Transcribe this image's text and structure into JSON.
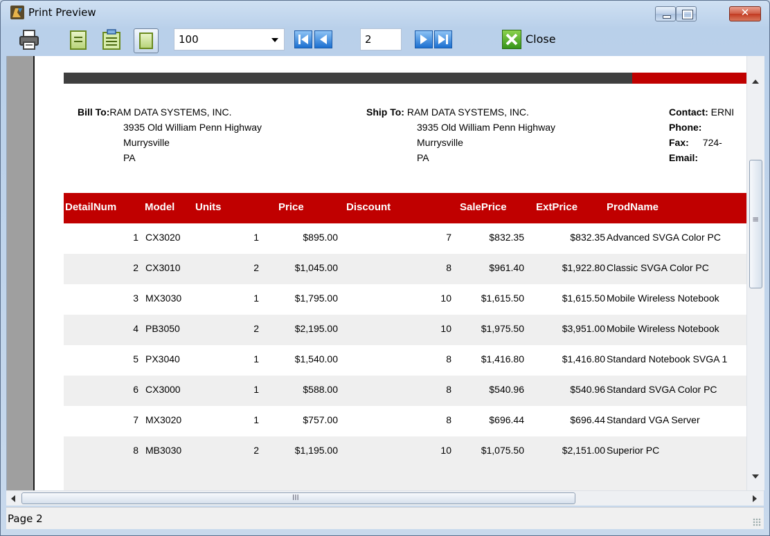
{
  "window": {
    "title": "Print Preview"
  },
  "toolbar": {
    "zoom_value": "100",
    "page_value": "2",
    "close_label": "Close"
  },
  "bill_to": {
    "label": "Bill To:",
    "name": "RAM DATA SYSTEMS, INC.",
    "street": "3935 Old William Penn Highway",
    "city": "Murrysville",
    "state": "PA"
  },
  "ship_to": {
    "label": "Ship To:",
    "name": "RAM DATA SYSTEMS, INC.",
    "street": "3935 Old William Penn Highway",
    "city": "Murrysville",
    "state": "PA"
  },
  "contact": {
    "contact_label": "Contact:",
    "contact_value": "ERNI",
    "phone_label": "Phone:",
    "fax_label": "Fax:",
    "fax_value": "724-",
    "email_label": "Email:"
  },
  "table": {
    "headers": [
      "DetailNum",
      "Model",
      "Units",
      "Price",
      "Discount",
      "SalePrice",
      "ExtPrice",
      "ProdName"
    ],
    "rows": [
      {
        "detail": "1",
        "model": "CX3020",
        "units": "1",
        "price": "$895.00",
        "discount": "7",
        "sale": "$832.35",
        "ext": "$832.35",
        "prod": "Advanced SVGA Color PC"
      },
      {
        "detail": "2",
        "model": "CX3010",
        "units": "2",
        "price": "$1,045.00",
        "discount": "8",
        "sale": "$961.40",
        "ext": "$1,922.80",
        "prod": "Classic SVGA Color PC"
      },
      {
        "detail": "3",
        "model": "MX3030",
        "units": "1",
        "price": "$1,795.00",
        "discount": "10",
        "sale": "$1,615.50",
        "ext": "$1,615.50",
        "prod": "Mobile Wireless Notebook"
      },
      {
        "detail": "4",
        "model": "PB3050",
        "units": "2",
        "price": "$2,195.00",
        "discount": "10",
        "sale": "$1,975.50",
        "ext": "$3,951.00",
        "prod": "Mobile Wireless Notebook"
      },
      {
        "detail": "5",
        "model": "PX3040",
        "units": "1",
        "price": "$1,540.00",
        "discount": "8",
        "sale": "$1,416.80",
        "ext": "$1,416.80",
        "prod": "Standard Notebook SVGA 1"
      },
      {
        "detail": "6",
        "model": "CX3000",
        "units": "1",
        "price": "$588.00",
        "discount": "8",
        "sale": "$540.96",
        "ext": "$540.96",
        "prod": "Standard SVGA Color PC"
      },
      {
        "detail": "7",
        "model": "MX3020",
        "units": "1",
        "price": "$757.00",
        "discount": "8",
        "sale": "$696.44",
        "ext": "$696.44",
        "prod": "Standard VGA Server"
      },
      {
        "detail": "8",
        "model": "MB3030",
        "units": "2",
        "price": "$1,195.00",
        "discount": "10",
        "sale": "$1,075.50",
        "ext": "$2,151.00",
        "prod": "Superior PC"
      }
    ]
  },
  "hscroll_grip": "III",
  "status": {
    "text": "Page 2"
  }
}
